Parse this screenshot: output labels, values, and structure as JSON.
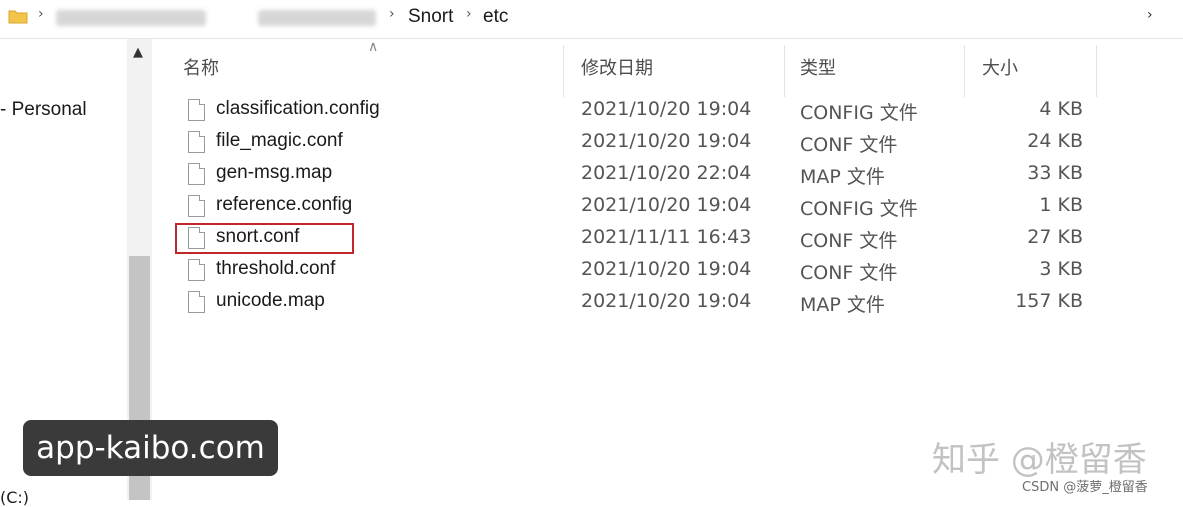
{
  "address_bar": {
    "breadcrumbs": [
      "Snort",
      "etc"
    ]
  },
  "nav_pane": {
    "items": [
      {
        "label": "- Personal"
      },
      {
        "label": "(C:)"
      }
    ]
  },
  "file_list": {
    "columns": {
      "name": "名称",
      "modified": "修改日期",
      "type": "类型",
      "size": "大小"
    },
    "rows": [
      {
        "name": "classification.config",
        "modified": "2021/10/20 19:04",
        "type": "CONFIG 文件",
        "size": "4 KB"
      },
      {
        "name": "file_magic.conf",
        "modified": "2021/10/20 19:04",
        "type": "CONF 文件",
        "size": "24 KB"
      },
      {
        "name": "gen-msg.map",
        "modified": "2021/10/20 22:04",
        "type": "MAP 文件",
        "size": "33 KB"
      },
      {
        "name": "reference.config",
        "modified": "2021/10/20 19:04",
        "type": "CONFIG 文件",
        "size": "1 KB"
      },
      {
        "name": "snort.conf",
        "modified": "2021/11/11 16:43",
        "type": "CONF 文件",
        "size": "27 KB"
      },
      {
        "name": "threshold.conf",
        "modified": "2021/10/20 19:04",
        "type": "CONF 文件",
        "size": "3 KB"
      },
      {
        "name": "unicode.map",
        "modified": "2021/10/20 19:04",
        "type": "MAP 文件",
        "size": "157 KB"
      }
    ]
  },
  "watermarks": {
    "site": "app-kaibo.com",
    "zhihu": "知乎 @橙留香",
    "csdn": "CSDN @菠萝_橙留香"
  },
  "colors": {
    "highlight_border": "#c0262d",
    "scrollbar_thumb": "#c4c4c4"
  }
}
